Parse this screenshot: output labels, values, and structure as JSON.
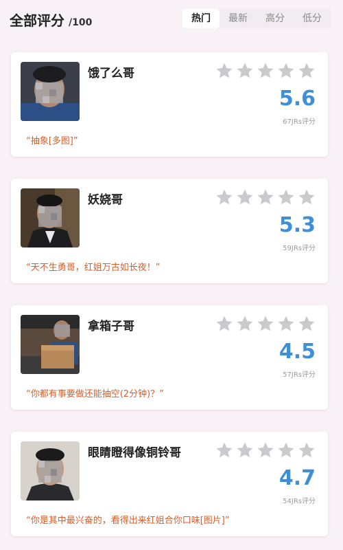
{
  "header": {
    "title": "全部评分",
    "subtitle": "/100",
    "tabs": [
      {
        "label": "热门",
        "active": true
      },
      {
        "label": "最新",
        "active": false
      },
      {
        "label": "高分",
        "active": false
      },
      {
        "label": "低分",
        "active": false
      }
    ]
  },
  "colors": {
    "score": "#3f8fd6",
    "quote": "#d0602e",
    "star_empty": "#c9c9ce"
  },
  "cards": [
    {
      "name": "饿了么哥",
      "score": "5.6",
      "count": "67JRs评分",
      "quote": "“抽象[多图]”",
      "stars_filled": 0,
      "stars_total": 5,
      "avatar": "person-photo-blurred"
    },
    {
      "name": "妖娆哥",
      "score": "5.3",
      "count": "59JRs评分",
      "quote": "“天不生勇哥，红姐万古如长夜！”",
      "stars_filled": 0,
      "stars_total": 5,
      "avatar": "person-photo-blurred"
    },
    {
      "name": "拿箱子哥",
      "score": "4.5",
      "count": "57JRs评分",
      "quote": "“你都有事要做还能抽空(2分钟)？”",
      "stars_filled": 0,
      "stars_total": 5,
      "avatar": "person-photo-blurred"
    },
    {
      "name": "眼睛瞪得像铜铃哥",
      "score": "4.7",
      "count": "54JRs评分",
      "quote": "“你是其中最兴奋的，看得出来红姐合你口味[图片]”",
      "stars_filled": 0,
      "stars_total": 5,
      "avatar": "person-photo-blurred"
    }
  ]
}
